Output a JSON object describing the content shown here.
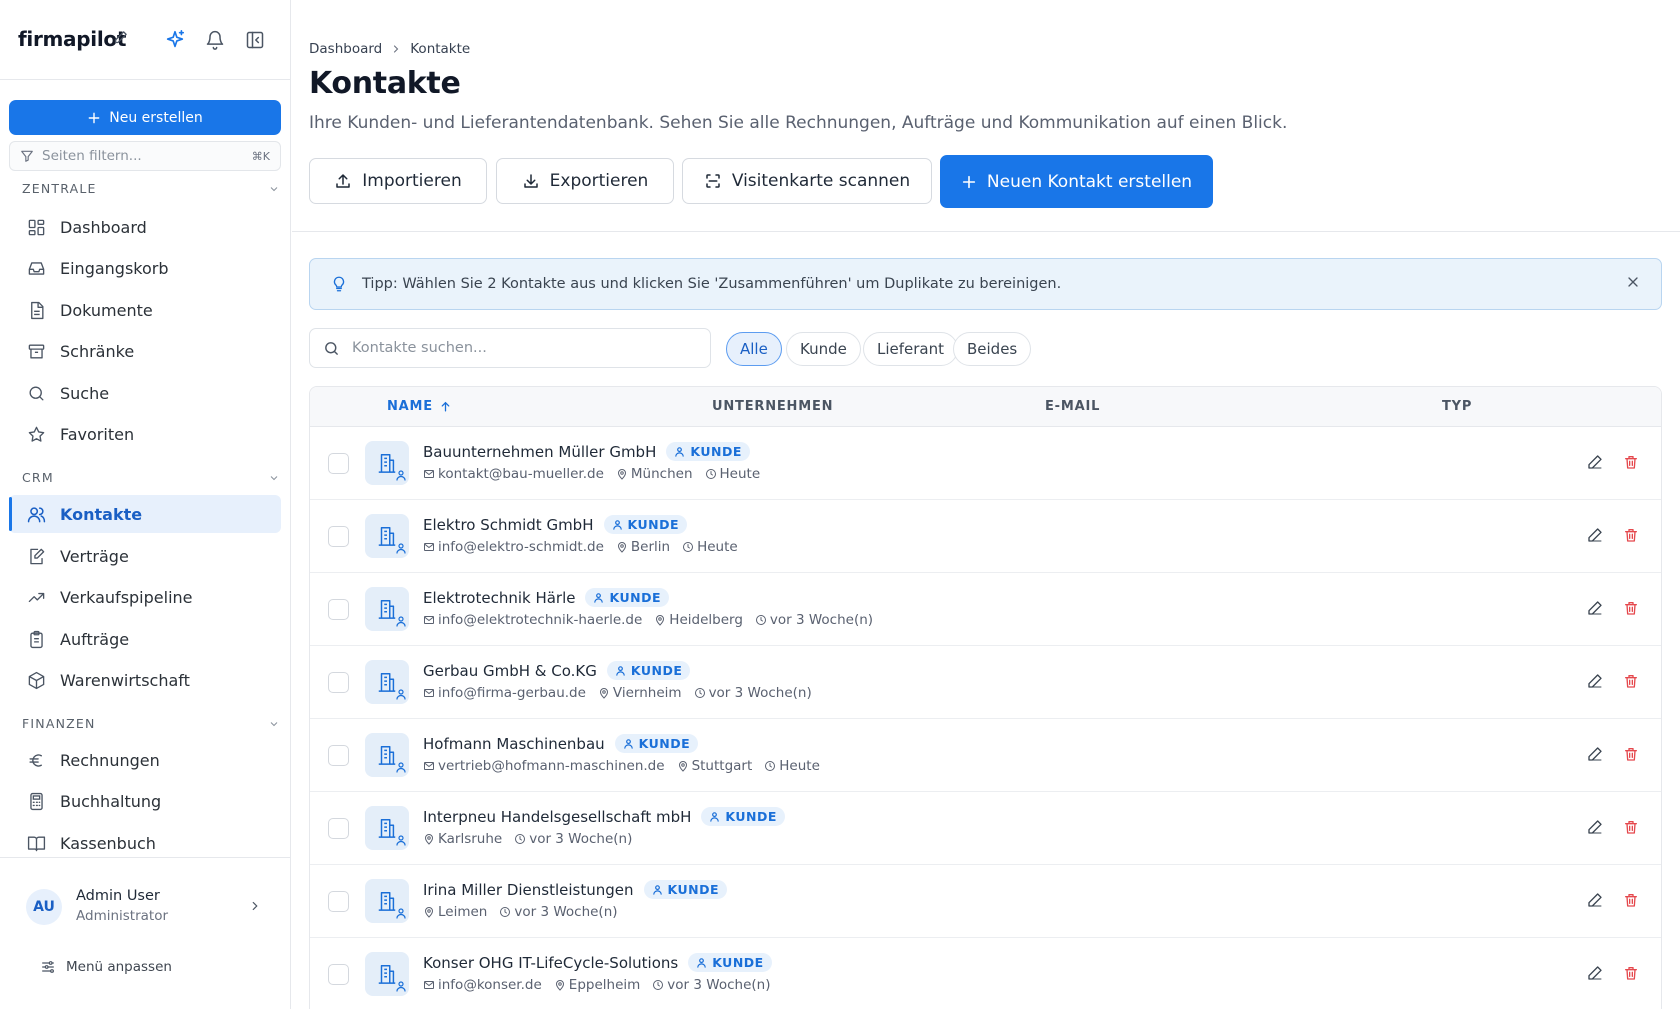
{
  "sidebar": {
    "brand": "firmapilot",
    "new_button": "Neu erstellen",
    "filter_placeholder": "Seiten filtern...",
    "filter_shortcut": "⌘K",
    "sections": {
      "zentrale": "ZENTRALE",
      "crm": "CRM",
      "finanzen": "FINANZEN"
    },
    "items": {
      "dashboard": "Dashboard",
      "eingangskorb": "Eingangskorb",
      "dokumente": "Dokumente",
      "schraenke": "Schränke",
      "suche": "Suche",
      "favoriten": "Favoriten",
      "kontakte": "Kontakte",
      "vertraege": "Verträge",
      "verkaufspipeline": "Verkaufspipeline",
      "auftraege": "Aufträge",
      "warenwirtschaft": "Warenwirtschaft",
      "rechnungen": "Rechnungen",
      "buchhaltung": "Buchhaltung",
      "kassenbuch": "Kassenbuch"
    },
    "user": {
      "initials": "AU",
      "name": "Admin User",
      "role": "Administrator"
    },
    "menu_customize": "Menü anpassen"
  },
  "header": {
    "breadcrumb": [
      "Dashboard",
      "Kontakte"
    ],
    "title": "Kontakte",
    "subtitle": "Ihre Kunden- und Lieferantendatenbank. Sehen Sie alle Rechnungen, Aufträge und Kommunikation auf einen Blick.",
    "actions": {
      "import": "Importieren",
      "export": "Exportieren",
      "scan": "Visitenkarte scannen",
      "create": "Neuen Kontakt erstellen"
    }
  },
  "tip": "Tipp: Wählen Sie 2 Kontakte aus und klicken Sie 'Zusammenführen' um Duplikate zu bereinigen.",
  "search_placeholder": "Kontakte suchen...",
  "filters": [
    "Alle",
    "Kunde",
    "Lieferant",
    "Beides"
  ],
  "table": {
    "columns": {
      "name": "NAME",
      "company": "UNTERNEHMEN",
      "email": "E-MAIL",
      "type": "TYP"
    },
    "rows": [
      {
        "name": "Bauunternehmen Müller GmbH",
        "badge": "KUNDE",
        "email": "kontakt@bau-mueller.de",
        "city": "München",
        "time": "Heute"
      },
      {
        "name": "Elektro Schmidt GmbH",
        "badge": "KUNDE",
        "email": "info@elektro-schmidt.de",
        "city": "Berlin",
        "time": "Heute"
      },
      {
        "name": "Elektrotechnik Härle",
        "badge": "KUNDE",
        "email": "info@elektrotechnik-haerle.de",
        "city": "Heidelberg",
        "time": "vor 3 Woche(n)"
      },
      {
        "name": "Gerbau GmbH & Co.KG",
        "badge": "KUNDE",
        "email": "info@firma-gerbau.de",
        "city": "Viernheim",
        "time": "vor 3 Woche(n)"
      },
      {
        "name": "Hofmann Maschinenbau",
        "badge": "KUNDE",
        "email": "vertrieb@hofmann-maschinen.de",
        "city": "Stuttgart",
        "time": "Heute"
      },
      {
        "name": "Interpneu Handelsgesellschaft mbH",
        "badge": "KUNDE",
        "email": "",
        "city": "Karlsruhe",
        "time": "vor 3 Woche(n)"
      },
      {
        "name": "Irina Miller Dienstleistungen",
        "badge": "KUNDE",
        "email": "",
        "city": "Leimen",
        "time": "vor 3 Woche(n)"
      },
      {
        "name": "Konser OHG IT-LifeCycle-Solutions",
        "badge": "KUNDE",
        "email": "info@konser.de",
        "city": "Eppelheim",
        "time": "vor 3 Woche(n)"
      }
    ]
  },
  "colors": {
    "primary": "#1976e8",
    "active_bg": "#e7f0fc",
    "danger": "#e5484d"
  }
}
